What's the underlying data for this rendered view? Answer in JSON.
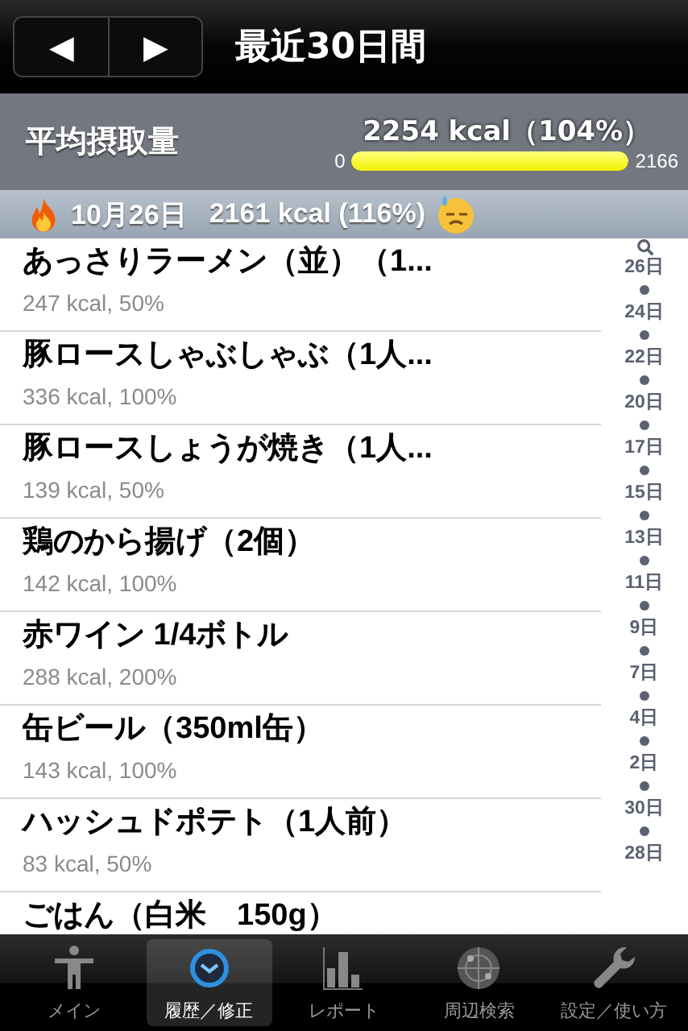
{
  "nav": {
    "prev": "◀",
    "next": "▶",
    "title": "最近30日間"
  },
  "summary": {
    "label": "平均摂取量",
    "value": "2254 kcal（104%）",
    "min": "0",
    "max": "2166",
    "level": 1
  },
  "section": {
    "date": "10月26日",
    "total": "2161 kcal (116%)"
  },
  "rows": [
    {
      "name": "あっさりラーメン（並）（1...",
      "detail": "247 kcal, 50%"
    },
    {
      "name": "豚ロースしゃぶしゃぶ（1人...",
      "detail": "336 kcal, 100%"
    },
    {
      "name": "豚ロースしょうが焼き（1人...",
      "detail": "139 kcal, 50%"
    },
    {
      "name": "鶏のから揚げ（2個）",
      "detail": "142 kcal, 100%"
    },
    {
      "name": "赤ワイン 1/4ボトル",
      "detail": "288 kcal, 200%"
    },
    {
      "name": "缶ビール（350ml缶）",
      "detail": "143 kcal, 100%"
    },
    {
      "name": "ハッシュドポテト（1人前）",
      "detail": "83 kcal, 50%"
    },
    {
      "name": "ごはん（白米　150g）"
    }
  ],
  "index": [
    "26日",
    "24日",
    "22日",
    "20日",
    "17日",
    "15日",
    "13日",
    "11日",
    "9日",
    "7日",
    "4日",
    "2日",
    "30日",
    "28日"
  ],
  "tabs": [
    {
      "label": "メイン",
      "kind": "person",
      "selected": false
    },
    {
      "label": "履歴／修正",
      "kind": "clock",
      "selected": true
    },
    {
      "label": "レポート",
      "kind": "chart",
      "selected": false
    },
    {
      "label": "周辺検索",
      "kind": "radar",
      "selected": false
    },
    {
      "label": "設定／使い方",
      "kind": "wrench",
      "selected": false
    }
  ]
}
